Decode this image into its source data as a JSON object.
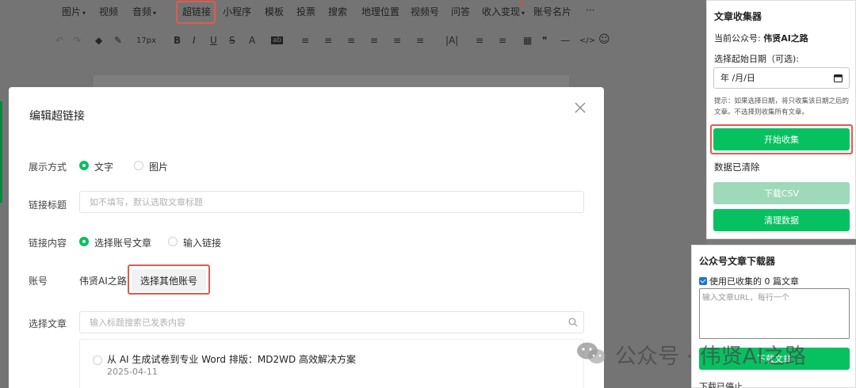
{
  "menu": {
    "items": [
      "图片",
      "视频",
      "音频",
      "超链接",
      "小程序",
      "模板",
      "投票",
      "搜索",
      "地理位置",
      "视频号",
      "问答",
      "收入变现",
      "账号名片"
    ],
    "more": "···",
    "caret": "▾"
  },
  "toolbar": {
    "undo": "↶",
    "redo": "↷",
    "fill": "◆",
    "brush": "✎",
    "font_size": "17px",
    "bold": "B",
    "italic": "I",
    "underline": "U",
    "strike": "S",
    "font_color": "A",
    "bg_color": "ab",
    "align": "≡",
    "spacing": "|A|",
    "table": "▦",
    "quote": "❞",
    "divider": "—",
    "code": "</>",
    "emoji": "☺"
  },
  "modal": {
    "title": "编辑超链接",
    "display_mode": {
      "label": "展示方式",
      "option_text": "文字",
      "option_image": "图片"
    },
    "link_title": {
      "label": "链接标题",
      "placeholder": "如不填写，默认选取文章标题"
    },
    "link_content": {
      "label": "链接内容",
      "option_account_article": "选择账号文章",
      "option_input_link": "输入链接"
    },
    "account": {
      "label": "账号",
      "name": "伟贤AI之路",
      "button": "选择其他账号"
    },
    "select_article": {
      "label": "选择文章",
      "placeholder": "输入标题搜索已发表内容"
    },
    "articles": [
      {
        "title": "从 AI 生成试卷到专业 Word 排版：MD2WD 高效解决方案",
        "date": "2025-04-11"
      }
    ]
  },
  "collector": {
    "title": "文章收集器",
    "current_account_label": "当前公众号: ",
    "current_account": "伟贤AI之路",
    "date_label": "选择起始日期（可选):",
    "date_value": "年 /月/日",
    "tip": "提示：如果选择日期，将只收集该日期之后的文章。不选择则收集所有文章。",
    "start_button": "开始收集",
    "status": "数据已清除",
    "download_csv": "下载CSV",
    "clear_button": "清理数据"
  },
  "downloader": {
    "title": "公众号文章下载器",
    "use_collected": "使用已收集的 0 篇文章",
    "url_placeholder": "输入文章URL，每行一个",
    "download_button": "下载文章",
    "status": "下载已停止"
  },
  "watermark": {
    "text": "公众号 · 伟贤AI之路"
  },
  "colors": {
    "accent": "#07c160",
    "highlight": "#e15b50",
    "overlay": "#747474"
  }
}
